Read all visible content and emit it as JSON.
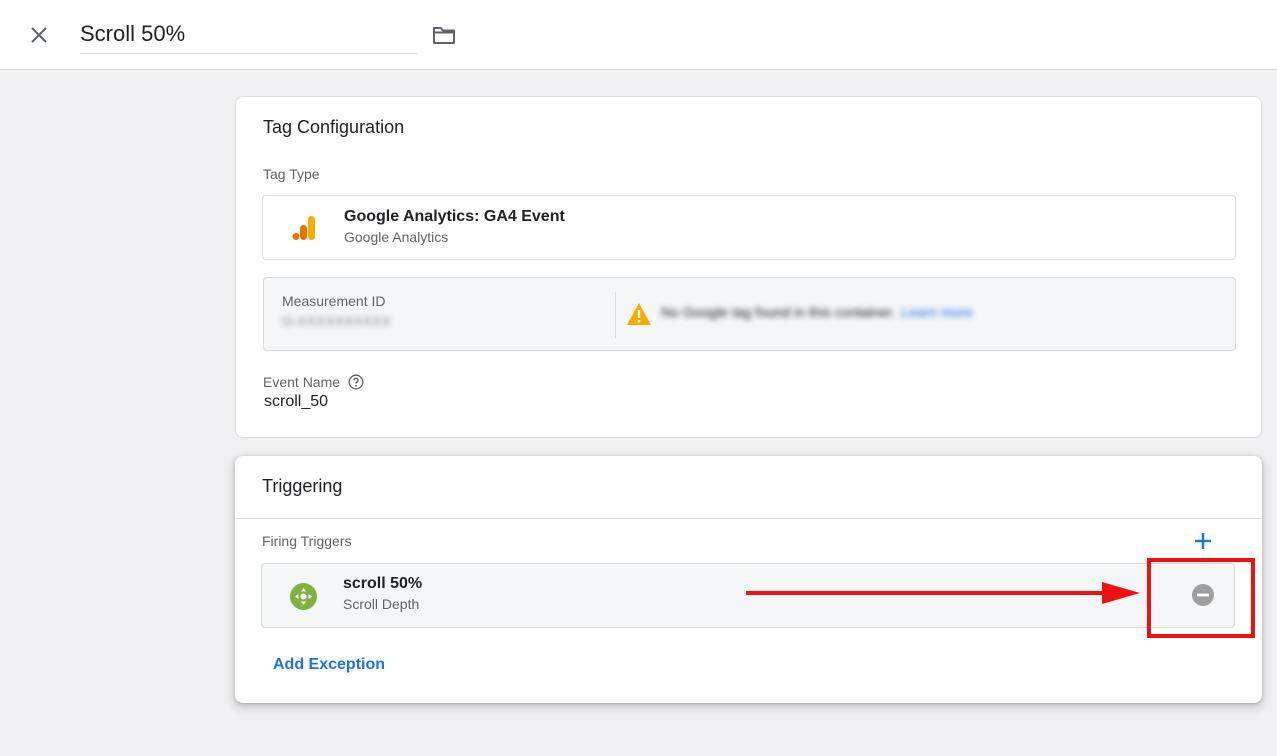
{
  "header": {
    "title_value": "Scroll 50%",
    "close_icon": "close-icon",
    "folder_icon": "folder-icon"
  },
  "tag_config": {
    "title": "Tag Configuration",
    "tag_type_label": "Tag Type",
    "tag_type": {
      "name": "Google Analytics: GA4 Event",
      "provider": "Google Analytics",
      "icon": "google-analytics-icon"
    },
    "measurement": {
      "label": "Measurement ID",
      "value": "G-XXXXXXXXXX",
      "warning_text": "No Google tag found in this container.",
      "warning_link": "Learn more",
      "warning_icon": "warning-icon"
    },
    "event_name_label": "Event Name",
    "event_name_value": "scroll_50"
  },
  "triggering": {
    "title": "Triggering",
    "firing_label": "Firing Triggers",
    "triggers": [
      {
        "name": "scroll 50%",
        "type": "Scroll Depth",
        "icon": "scroll-depth-icon"
      }
    ],
    "add_exception": "Add Exception"
  },
  "colors": {
    "accent": "#1a73e8",
    "annotation": "#ee1111",
    "ga_orange": "#f9ab00",
    "ga_dark": "#e37400",
    "scroll_green": "#7cb342"
  }
}
